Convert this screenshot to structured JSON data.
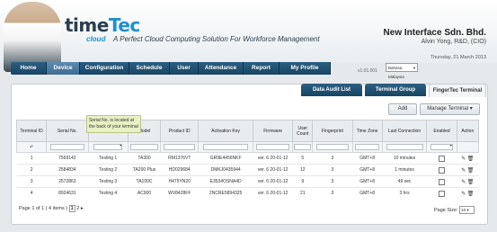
{
  "header": {
    "logo_part1": "time",
    "logo_part2": "Tec",
    "logo_sub": "cloud",
    "tagline": "A Perfect Cloud Computing Solution For Workforce Management",
    "company": "New Interface Sdn. Bhd.",
    "user": "Alvin Yong, R&D, (CIO)",
    "date": "Thursday, 21 March 2013",
    "language": "Bahasa Malaysia",
    "version": "v1.01.001"
  },
  "nav": [
    "Home",
    "Device",
    "Configuration",
    "Schedule",
    "User",
    "Attendance",
    "Report",
    "My Profile"
  ],
  "tabs": [
    "Data Audit List",
    "Terminal Group",
    "FingerTec Terminal"
  ],
  "toolbar": {
    "add": "Add",
    "manage": "Manage Terminal"
  },
  "tooltip": "Serial No. is located at the back of your terminal",
  "columns": [
    "Terminal ID",
    "Serial No.",
    "Description",
    "Model",
    "Product ID",
    "Activation Key",
    "Firmware",
    "User Count",
    "Fingerprint",
    "Time Zone",
    "Last Connection",
    "Enabled",
    "Action"
  ],
  "rows": [
    {
      "tid": "1",
      "serial": "7569142",
      "desc": "Testing 1",
      "model": "TA300",
      "pid": "RM1376VT",
      "key": "GR9E4456NKF",
      "fw": "ver. 6  20-01-12",
      "users": "5",
      "fp": "3",
      "tz": "GMT+8",
      "last": "10 minutes"
    },
    {
      "tid": "2",
      "serial": "2584834",
      "desc": "Testing 2",
      "model": "TA200 Plus",
      "pid": "HD029684",
      "key": "DMKJ0435944",
      "fw": "ver. 6  20-01-12",
      "users": "12",
      "fp": "3",
      "tz": "GMT+8",
      "last": "1 minutes"
    },
    {
      "tid": "3",
      "serial": "2572863",
      "desc": "Testing 3",
      "model": "TA100C",
      "pid": "H475YN20",
      "key": "E3534OSNA4D",
      "fw": "ver. 6  20-01-12",
      "users": "9",
      "fp": "3",
      "tz": "GMT+8",
      "last": "49 sec"
    },
    {
      "tid": "4",
      "serial": "8924631",
      "desc": "Testing 4",
      "model": "AC900",
      "pid": "WV8428FF",
      "key": "2NCRE5894325",
      "fw": "ver. 6  20-01-12",
      "users": "21",
      "fp": "3",
      "tz": "GMT+8",
      "last": "3 hrs"
    }
  ],
  "pager": {
    "text": "Page 1 of 1 ( 4 items )",
    "current": "1",
    "next": "2",
    "size_label": "Page Size:",
    "size": "10"
  }
}
